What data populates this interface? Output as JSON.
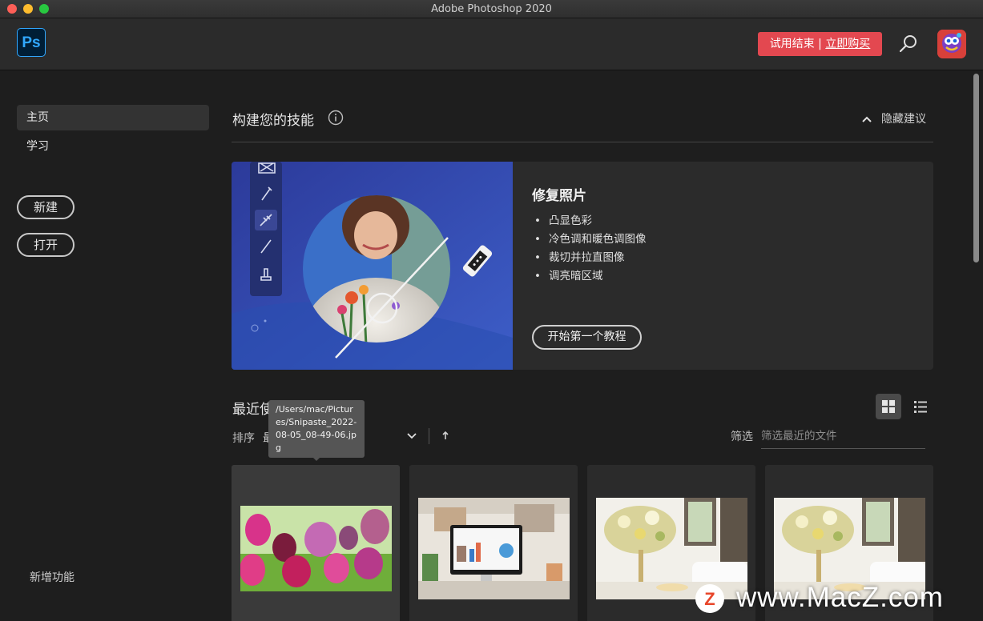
{
  "window": {
    "title": "Adobe Photoshop 2020"
  },
  "appbar": {
    "logo_text": "Ps",
    "trial_text": "试用结束",
    "trial_sep": "|",
    "buy_text": "立即购买",
    "colors": {
      "trial_bg": "#e34850",
      "ps_accent": "#31a8ff"
    }
  },
  "sidebar": {
    "items": [
      {
        "label": "主页",
        "active": true
      },
      {
        "label": "学习",
        "active": false
      }
    ],
    "new_label": "新建",
    "open_label": "打开",
    "new_features": "新增功能"
  },
  "skills": {
    "title": "构建您的技能",
    "hide_label": "隐藏建议",
    "card": {
      "title": "修复照片",
      "bullets": [
        "凸显色彩",
        "冷色调和暖色调图像",
        "裁切并拉直图像",
        "调亮暗区域"
      ],
      "button": "开始第一个教程"
    }
  },
  "recent": {
    "title": "最近使用",
    "sort_label": "排序",
    "sort_value": "最",
    "filter_label": "筛选",
    "filter_placeholder": "筛选最近的文件",
    "tooltip": "/Users/mac/Pictures/Snipaste_2022-08-05_08-49-06.jpg",
    "files": [
      {
        "thumb": "tulips"
      },
      {
        "thumb": "desk-monitor"
      },
      {
        "thumb": "dining-flowers"
      },
      {
        "thumb": "dining-flowers"
      }
    ]
  },
  "watermark": {
    "text": "www.MacZ.com",
    "logo": "Z"
  }
}
